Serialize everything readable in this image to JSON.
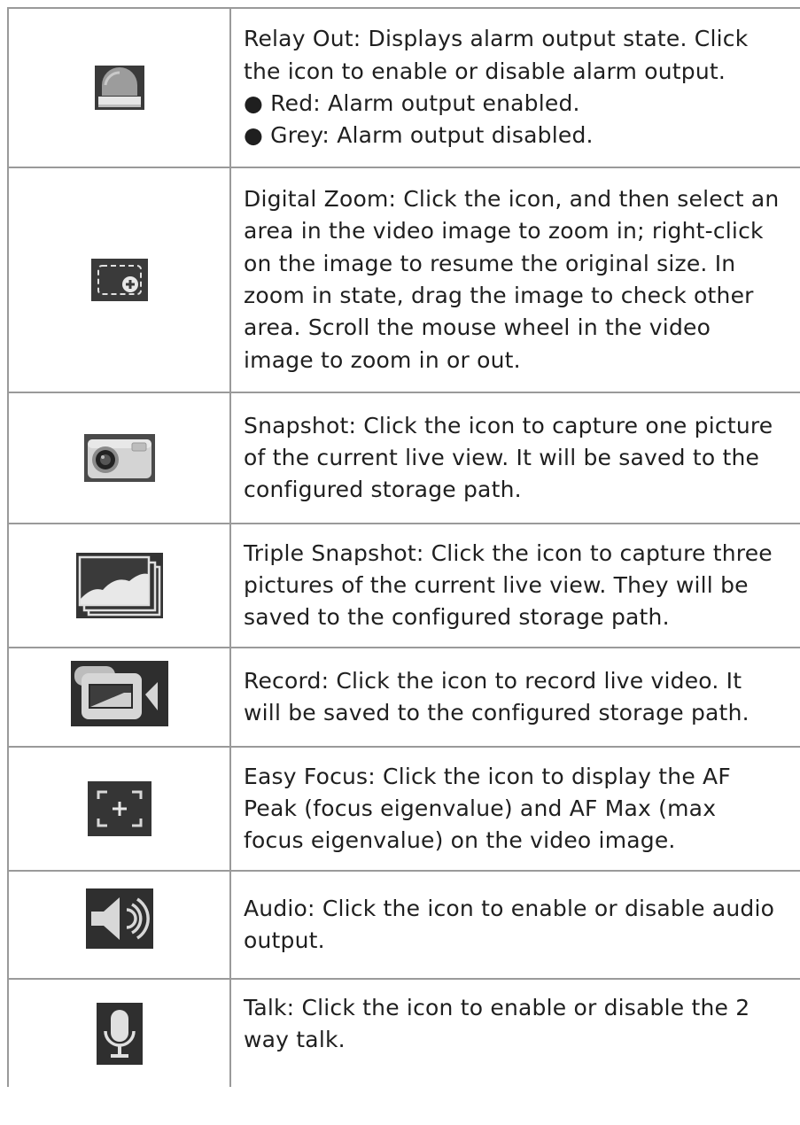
{
  "rows": [
    {
      "icon": "relay-out-icon",
      "lines": [
        "Relay Out: Displays alarm output state. Click",
        "the icon to enable or disable alarm output.",
        "● Red: Alarm output enabled.",
        "● Grey: Alarm output disabled."
      ]
    },
    {
      "icon": "digital-zoom-icon",
      "lines": [
        "Digital Zoom: Click the icon, and then select an",
        "area in the video image to zoom in; right-click",
        "on the image to resume the original size. In",
        "zoom in state, drag the image to check other",
        "area. Scroll the mouse wheel in the video",
        "image to zoom in or out."
      ]
    },
    {
      "icon": "snapshot-icon",
      "lines": [
        "Snapshot: Click the icon to capture one picture",
        "of the current live view. It will be saved to the",
        "configured storage path."
      ]
    },
    {
      "icon": "triple-snapshot-icon",
      "lines": [
        "Triple Snapshot: Click the icon to capture three",
        "pictures of the current live view. They will be",
        "saved to the configured storage path."
      ]
    },
    {
      "icon": "record-icon",
      "lines": [
        "Record: Click the icon to record live video. It",
        "will be saved to the configured storage path."
      ]
    },
    {
      "icon": "easy-focus-icon",
      "lines": [
        "Easy Focus: Click the icon to display the AF",
        "Peak (focus eigenvalue) and AF Max (max",
        "focus eigenvalue) on the video image."
      ]
    },
    {
      "icon": "audio-icon",
      "lines": [
        "Audio: Click the icon to enable or disable audio",
        "output."
      ]
    },
    {
      "icon": "talk-icon",
      "lines": [
        "Talk: Click the icon to enable or disable the 2",
        "way talk."
      ]
    }
  ]
}
